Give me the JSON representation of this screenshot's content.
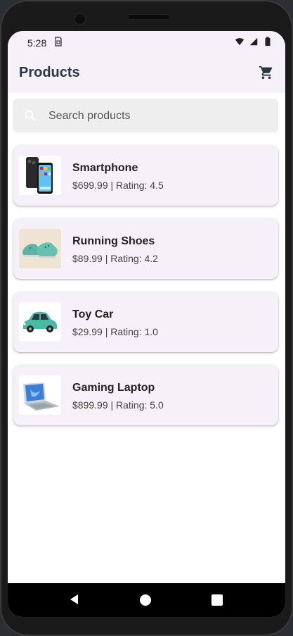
{
  "status": {
    "time": "5:28",
    "sim_icon": "sim-icon",
    "wifi_icon": "wifi-icon",
    "signal_icon": "signal-icon",
    "battery_icon": "battery-icon"
  },
  "appbar": {
    "title": "Products",
    "cart_icon": "cart-icon"
  },
  "search": {
    "placeholder": "Search products",
    "value": ""
  },
  "products": [
    {
      "name": "Smartphone",
      "meta": "$699.99 | Rating: 4.5",
      "image_icon": "smartphone-image"
    },
    {
      "name": "Running Shoes",
      "meta": "$89.99 | Rating: 4.2",
      "image_icon": "shoes-image"
    },
    {
      "name": "Toy Car",
      "meta": "$29.99 | Rating: 1.0",
      "image_icon": "toy-car-image"
    },
    {
      "name": "Gaming Laptop",
      "meta": "$899.99 | Rating: 5.0",
      "image_icon": "laptop-image"
    }
  ],
  "colors": {
    "surface": "#f6f1f8",
    "title": "#2b3640",
    "search_bg": "#eeeeee",
    "device": "#1a1a1a"
  },
  "navbar": {
    "back_icon": "back-icon",
    "home_icon": "home-icon",
    "recents_icon": "recents-icon"
  }
}
